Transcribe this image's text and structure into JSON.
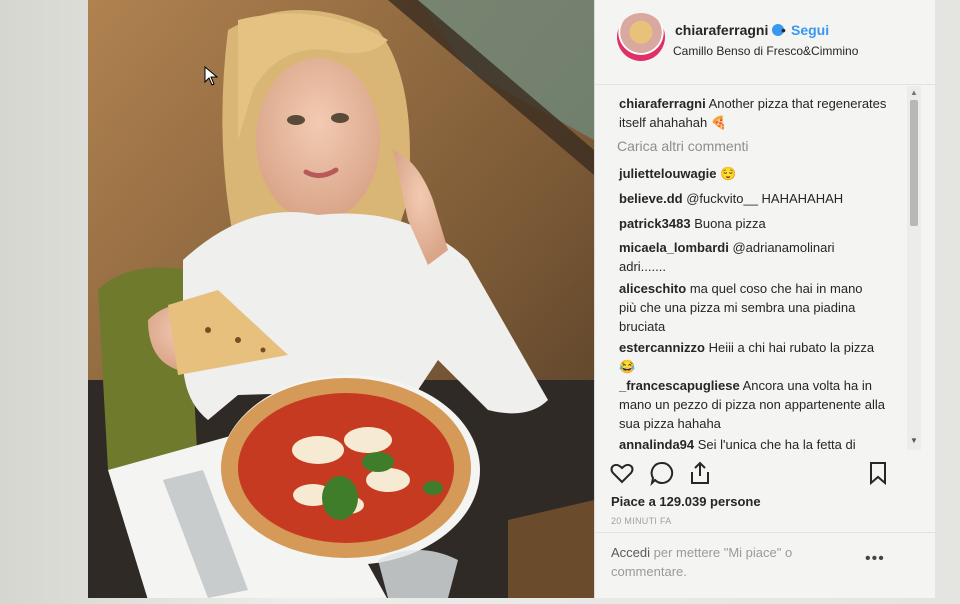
{
  "post": {
    "username": "chiaraferragni",
    "follow_label": "Segui",
    "separator": "•",
    "location": "Camillo Benso di Fresco&Cimmino",
    "caption": {
      "user": "chiaraferragni",
      "text": "Another pizza that regenerates itself ahahahah 🍕"
    },
    "load_more": "Carica altri commenti",
    "comments": [
      {
        "user": "juliettelouwagie",
        "text": "😌"
      },
      {
        "user": "believe.dd",
        "text": "@fuckvito__ HAHAHAHAH"
      },
      {
        "user": "patrick3483",
        "text": "Buona pizza"
      },
      {
        "user": "micaela_lombardi",
        "text": "@adrianamolinari adri......."
      },
      {
        "user": "aliceschito",
        "text": "ma quel coso che hai in mano più che una pizza mi sembra una piadina bruciata"
      },
      {
        "user": "estercannizzo",
        "text": "Heiii a chi hai rubato la pizza 😂"
      },
      {
        "user": "_francescapugliese",
        "text": "Ancora una volta ha in mano un pezzo di pizza non appartenente alla sua pizza hahaha"
      },
      {
        "user": "annalinda94",
        "text": "Sei l'unica che ha la fetta di"
      }
    ],
    "likes": "Piace a 129.039 persone",
    "time": "20 MINUTI FA",
    "login_link": "Accedi",
    "login_text": " per mettere \"Mi piace\" o commentare.",
    "more_label": "•••"
  },
  "icons": [
    "heart-icon",
    "comment-icon",
    "share-icon",
    "bookmark-icon",
    "verified-icon",
    "cursor-icon"
  ],
  "colors": {
    "link_blue": "#3897f0",
    "text": "#262626",
    "muted": "#8e8e8e"
  }
}
